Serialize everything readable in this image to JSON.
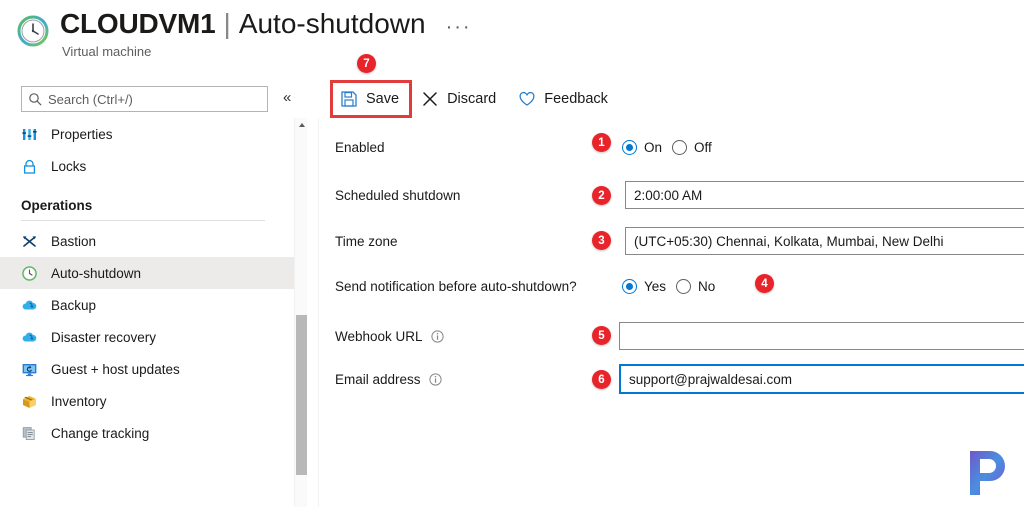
{
  "header": {
    "vm_icon": "clock-icon",
    "title_main": "CLOUDVM1",
    "title_separator": "|",
    "title_sub": "Auto-shutdown",
    "more_menu": "···",
    "subtitle": "Virtual machine"
  },
  "search": {
    "placeholder": "Search (Ctrl+/)",
    "value": "",
    "icon": "search-icon"
  },
  "collapse": {
    "glyph": "«",
    "name": "collapse-panel-chevron"
  },
  "sidebar": {
    "top_items": [
      {
        "label": "Properties",
        "icon": "properties-icon",
        "selected": false
      },
      {
        "label": "Locks",
        "icon": "lock-icon",
        "selected": false
      }
    ],
    "section_title": "Operations",
    "operations_items": [
      {
        "label": "Bastion",
        "icon": "bastion-icon",
        "selected": false
      },
      {
        "label": "Auto-shutdown",
        "icon": "clock-icon",
        "selected": true
      },
      {
        "label": "Backup",
        "icon": "cloud-backup-icon",
        "selected": false
      },
      {
        "label": "Disaster recovery",
        "icon": "cloud-recovery-icon",
        "selected": false
      },
      {
        "label": "Guest + host updates",
        "icon": "monitor-update-icon",
        "selected": false
      },
      {
        "label": "Inventory",
        "icon": "inventory-box-icon",
        "selected": false
      },
      {
        "label": "Change tracking",
        "icon": "change-tracking-icon",
        "selected": false
      }
    ]
  },
  "toolbar": {
    "save_label": "Save",
    "save_icon": "save-disk-icon",
    "discard_label": "Discard",
    "discard_icon": "close-x-icon",
    "feedback_label": "Feedback",
    "feedback_icon": "heart-icon",
    "highlight_color": "#e03c3c"
  },
  "form": {
    "enabled": {
      "label": "Enabled",
      "options": [
        "On",
        "Off"
      ],
      "selected": "On"
    },
    "scheduled_shutdown": {
      "label": "Scheduled shutdown",
      "value": "2:00:00 AM",
      "placeholder": ""
    },
    "time_zone": {
      "label": "Time zone",
      "value": "(UTC+05:30) Chennai, Kolkata, Mumbai, New Delhi",
      "placeholder": ""
    },
    "send_notification": {
      "label": "Send notification before auto-shutdown?",
      "options": [
        "Yes",
        "No"
      ],
      "selected": "Yes"
    },
    "webhook_url": {
      "label": "Webhook URL",
      "value": "",
      "placeholder": "",
      "info_icon": "info-icon"
    },
    "email_address": {
      "label": "Email address",
      "value": "support@prajwaldesai.com",
      "placeholder": "",
      "info_icon": "info-icon",
      "focused": true
    }
  },
  "badges": {
    "b1": "1",
    "b2": "2",
    "b3": "3",
    "b4": "4",
    "b5": "5",
    "b6": "6",
    "b7": "7",
    "color": "#e8232a"
  },
  "watermark": {
    "letter": "P",
    "name": "site-logo-watermark"
  },
  "colors": {
    "accent": "#0078d4",
    "selected_row": "#edebe9",
    "badge_red": "#e8232a",
    "highlight_red": "#e03c3c"
  }
}
